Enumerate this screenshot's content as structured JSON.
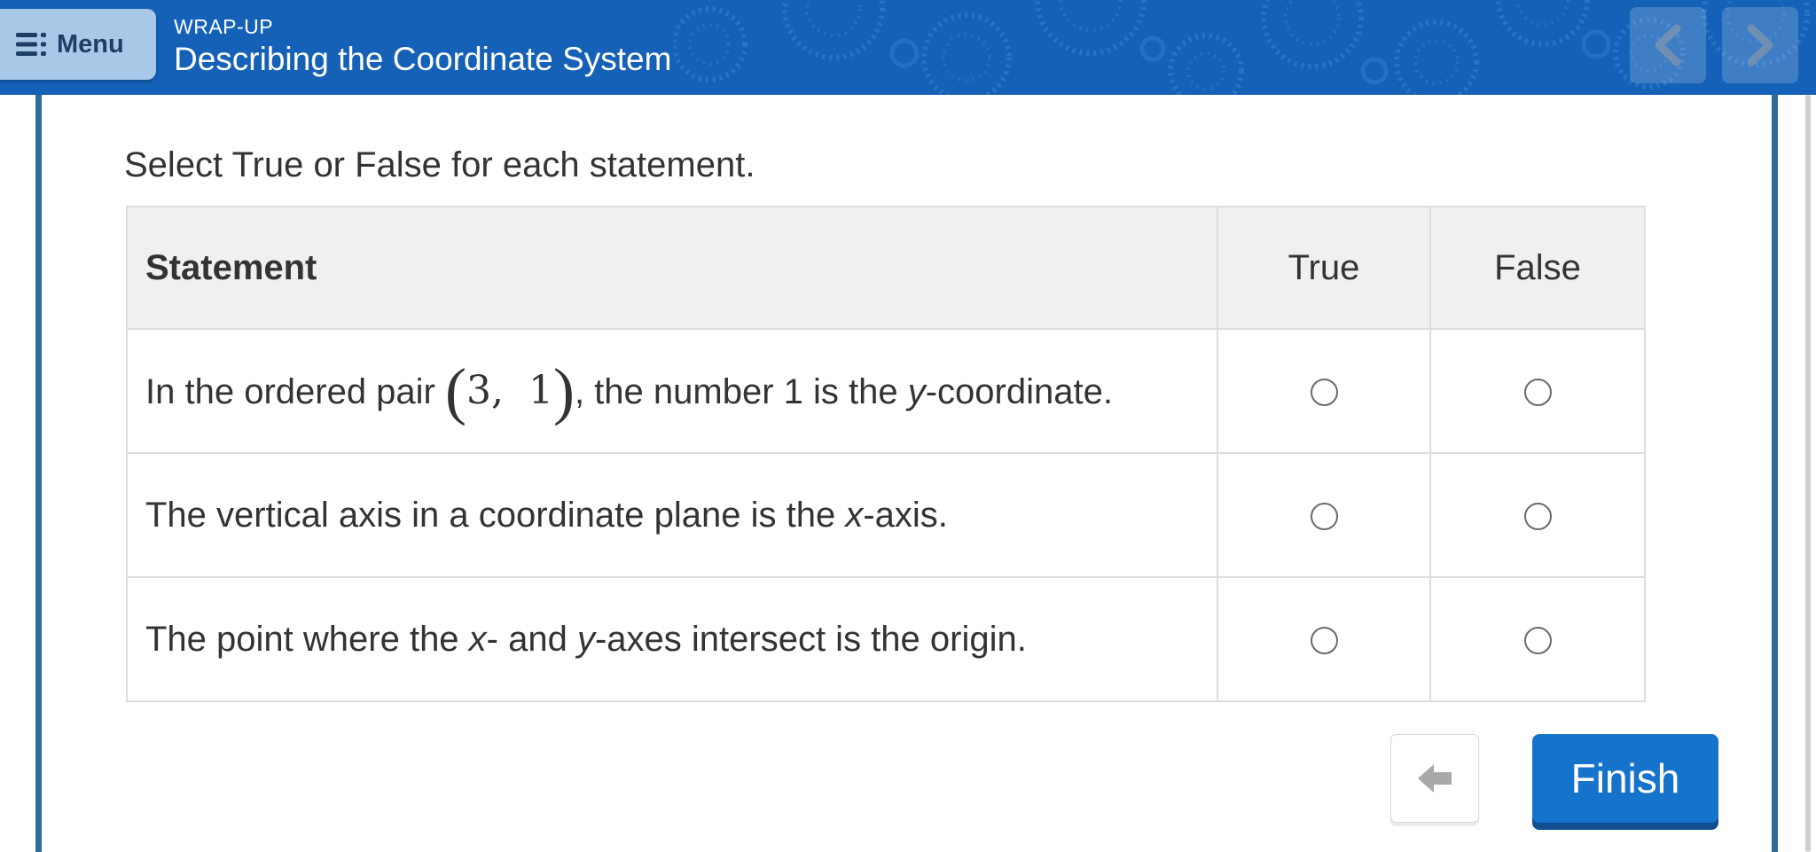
{
  "header": {
    "menu_label": "Menu",
    "menu_icon": "list-menu-icon",
    "eyebrow": "WRAP-UP",
    "title": "Describing the Coordinate System",
    "prev_icon": "chevron-left-icon",
    "next_icon": "chevron-right-icon"
  },
  "main": {
    "instruction": "Select True or False for each statement.",
    "table": {
      "headers": [
        "Statement",
        "True",
        "False"
      ],
      "rows": [
        {
          "pre": "In the ordered pair ",
          "pair_left": "(",
          "pair_a": "3,",
          "pair_b": "1",
          "pair_right": ")",
          "mid": ", the number 1 is the ",
          "var": "y",
          "post": "-coordinate.",
          "true_selected": false,
          "false_selected": false
        },
        {
          "pre": "The vertical axis in a coordinate plane is the ",
          "var": "x",
          "post": "-axis.",
          "true_selected": false,
          "false_selected": false
        },
        {
          "pre": "The point where the ",
          "var1": "x",
          "mid": "- and ",
          "var2": "y",
          "post": "-axes intersect is the origin.",
          "true_selected": false,
          "false_selected": false
        }
      ]
    }
  },
  "footer": {
    "back_icon": "arrow-left-icon",
    "finish_label": "Finish"
  },
  "colors": {
    "header_bg": "#1561b8",
    "menu_bg": "#a8c8e8",
    "finish_bg": "#1673cc",
    "frame": "#2f6c98"
  }
}
